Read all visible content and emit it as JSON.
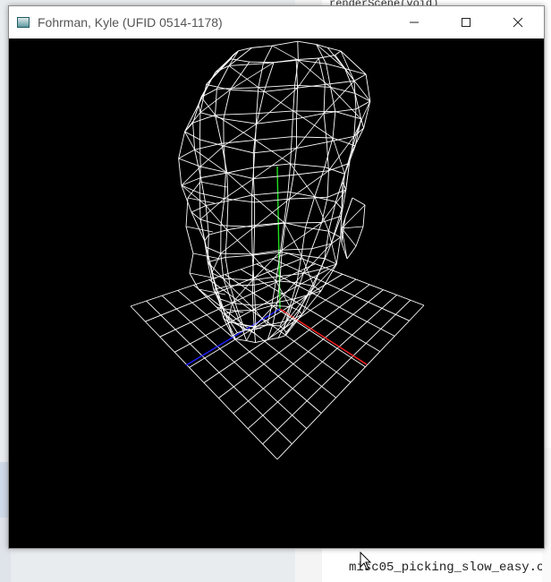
{
  "window": {
    "title": "Fohrman, Kyle (UFID 0514-1178)",
    "icon": "app-icon",
    "controls": [
      "minimize-icon",
      "maximize-icon",
      "close-icon"
    ]
  },
  "background": {
    "code_line": "renderScene(void)",
    "console_line": "misc05_picking_slow_easy.c"
  },
  "scene": {
    "axis_colors": {
      "x": "#ff2020",
      "y": "#20e020",
      "z": "#2020ff"
    },
    "wire_color": "#ffffff",
    "grid_divisions": 10
  }
}
